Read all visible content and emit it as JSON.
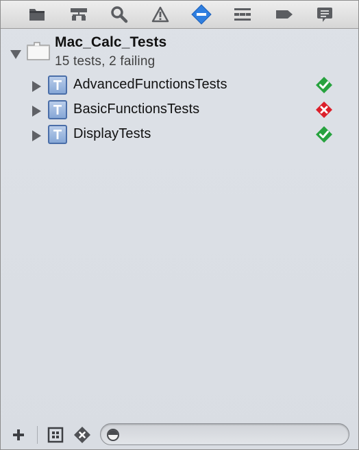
{
  "toolbar": {
    "icons": [
      "folder-icon",
      "hierarchy-icon",
      "search-icon",
      "warning-icon",
      "test-icon",
      "debug-icon",
      "breakpoint-icon",
      "log-icon"
    ],
    "selected": "test-icon",
    "accent_color": "#2f7fe0"
  },
  "tree": {
    "root": {
      "title": "Mac_Calc_Tests",
      "subtitle": "15 tests, 2 failing"
    },
    "items": [
      {
        "label": "AdvancedFunctionsTests",
        "status": "passed"
      },
      {
        "label": "BasicFunctionsTests",
        "status": "failed"
      },
      {
        "label": "DisplayTests",
        "status": "passed"
      }
    ],
    "colors": {
      "passed": "#27a23e",
      "failed": "#dc1f2a"
    }
  },
  "bottombar": {
    "add_symbol": "+",
    "filter_placeholder": ""
  }
}
